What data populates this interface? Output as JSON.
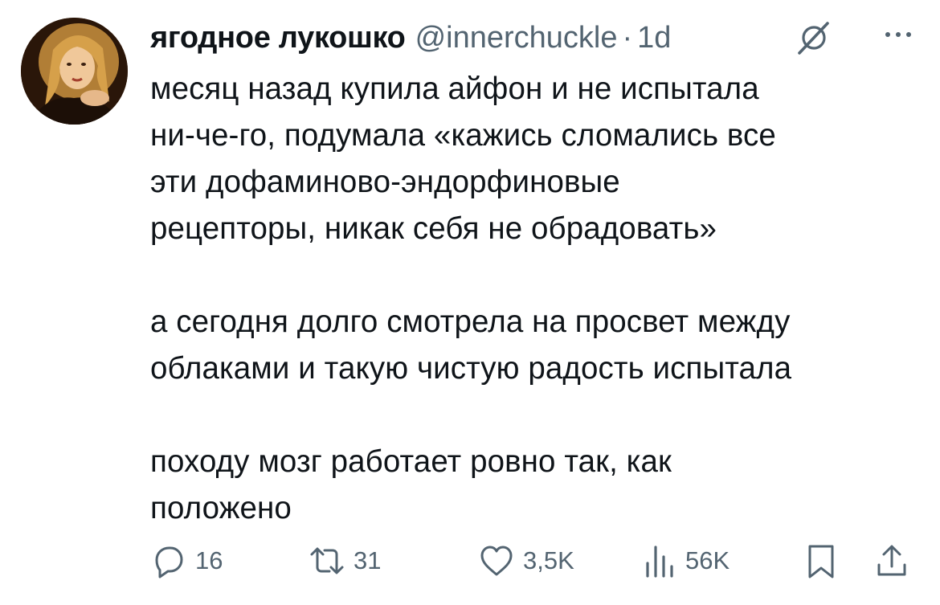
{
  "tweet": {
    "author": {
      "display_name": "ягодное лукошко",
      "handle": "@innerchuckle",
      "separator": "·",
      "time": "1d",
      "avatar_icon": "avatar"
    },
    "header_icons": {
      "grok": "grok-icon",
      "more": "more-icon"
    },
    "text": {
      "paragraph_1": [
        "месяц назад купила айфон и не испытала",
        "ни-че-го, подумала «кажись сломались все",
        "эти дофаминово-эндорфиновые",
        "рецепторы, никак себя не обрадовать»"
      ],
      "paragraph_2": [
        "а сегодня долго смотрела на просвет между",
        "облаками и такую чистую радость испытала"
      ],
      "paragraph_3": [
        "походу мозг работает ровно так, как",
        "положено"
      ]
    },
    "actions": {
      "reply": {
        "icon": "reply-icon",
        "count": "16"
      },
      "retweet": {
        "icon": "retweet-icon",
        "count": "31"
      },
      "like": {
        "icon": "heart-icon",
        "count": "3,5K"
      },
      "views": {
        "icon": "views-icon",
        "count": "56K"
      },
      "bookmark": {
        "icon": "bookmark-icon"
      },
      "share": {
        "icon": "share-icon"
      }
    },
    "colors": {
      "text_primary": "#0f1419",
      "text_secondary": "#536471",
      "background": "#ffffff"
    }
  }
}
